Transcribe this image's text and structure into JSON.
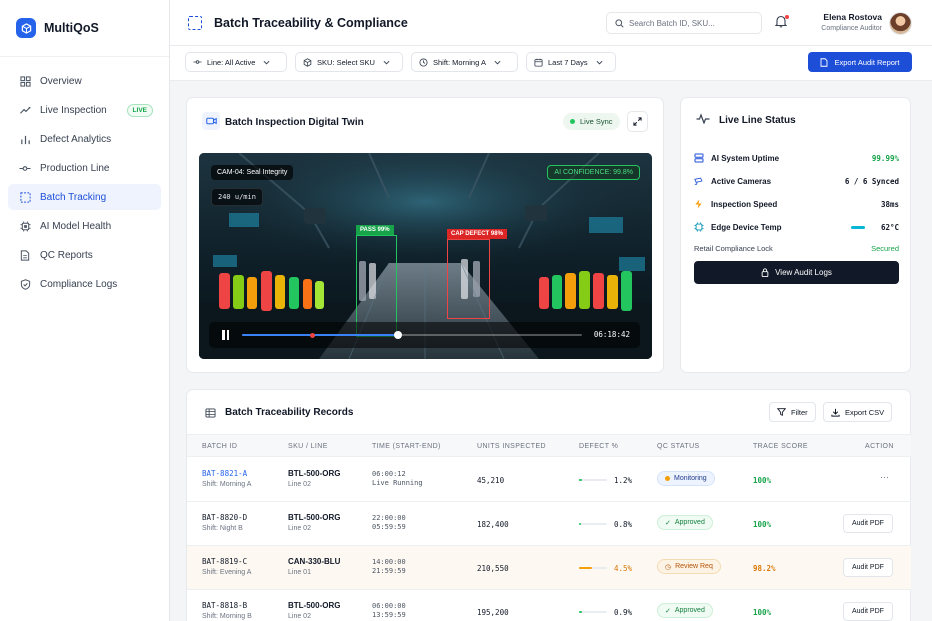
{
  "app": {
    "name": "MultiQoS"
  },
  "sidebar": {
    "items": [
      {
        "label": "Overview",
        "icon": "grid-icon"
      },
      {
        "label": "Live Inspection",
        "icon": "radar-icon",
        "badge": "LIVE"
      },
      {
        "label": "Defect Analytics",
        "icon": "bar-chart-icon"
      },
      {
        "label": "Production Line",
        "icon": "pipeline-icon"
      },
      {
        "label": "Batch Tracking",
        "icon": "scan-box-icon",
        "active": true
      },
      {
        "label": "AI Model Health",
        "icon": "chip-icon"
      },
      {
        "label": "QC Reports",
        "icon": "document-icon"
      },
      {
        "label": "Compliance Logs",
        "icon": "shield-icon"
      }
    ]
  },
  "header": {
    "title": "Batch Traceability & Compliance",
    "search_placeholder": "Search Batch ID, SKU...",
    "user_name": "Elena Rostova",
    "user_role": "Compliance Auditor"
  },
  "filters": {
    "line": "Line: All Active",
    "sku": "SKU: Select SKU",
    "shift": "Shift: Morning A",
    "range": "Last 7 Days",
    "export_label": "Export Audit Report"
  },
  "twin": {
    "title": "Batch Inspection Digital Twin",
    "sync_label": "Live Sync",
    "camera_label": "CAM-04: Seal Integrity",
    "rate_label": "240 u/min",
    "ai_label": "AI CONFIDENCE: 99.8%",
    "pass_label": "PASS 99%",
    "defect_label": "CAP DEFECT 98%",
    "timecode": "06:18:42",
    "progress": 0.46
  },
  "status": {
    "title": "Live Line Status",
    "rows": [
      {
        "label": "AI System Uptime",
        "value": "99.99%",
        "color": "#16a34a",
        "icon": "server-icon"
      },
      {
        "label": "Active Cameras",
        "value": "6 / 6 Synced",
        "color": "#111827",
        "icon": "camera-icon"
      },
      {
        "label": "Inspection Speed",
        "value": "38ms",
        "color": "#111827",
        "icon": "lightning-icon"
      },
      {
        "label": "Edge Device Temp",
        "value": "62°C",
        "color": "#111827",
        "icon": "cpu-icon"
      }
    ],
    "lock_label": "Retail Compliance Lock",
    "lock_value": "Secured",
    "logs_button": "View Audit Logs"
  },
  "records": {
    "title": "Batch Traceability Records",
    "filter_label": "Filter",
    "csv_label": "Export CSV",
    "columns": [
      "BATCH ID",
      "SKU / LINE",
      "TIME (START-END)",
      "UNITS INSPECTED",
      "DEFECT %",
      "QC STATUS",
      "TRACE SCORE",
      "ACTION"
    ],
    "rows": [
      {
        "id": "BAT-8821-A",
        "shift": "Shift: Morning A",
        "sku": "BTL-500-ORG",
        "line": "Line 02",
        "start": "06:00:12",
        "end": "Live Running",
        "units": "45,210",
        "defect": "1.2%",
        "defect_frac": 0.12,
        "status": "Monitoring",
        "score": "100%",
        "action": "···"
      },
      {
        "id": "BAT-8820-D",
        "shift": "Shift: Night B",
        "sku": "BTL-500-ORG",
        "line": "Line 02",
        "start": "22:00:00",
        "end": "05:59:59",
        "units": "182,400",
        "defect": "0.8%",
        "defect_frac": 0.08,
        "status": "Approved",
        "score": "100%",
        "action": "Audit PDF"
      },
      {
        "id": "BAT-8819-C",
        "shift": "Shift: Evening A",
        "sku": "CAN-330-BLU",
        "line": "Line 01",
        "start": "14:00:00",
        "end": "21:59:59",
        "units": "210,550",
        "defect": "4.5%",
        "defect_frac": 0.45,
        "status": "Review Req",
        "score": "98.2%",
        "action": "Audit PDF"
      },
      {
        "id": "BAT-8818-B",
        "shift": "Shift: Morning B",
        "sku": "BTL-500-ORG",
        "line": "Line 02",
        "start": "06:00:00",
        "end": "13:59:59",
        "units": "195,200",
        "defect": "0.9%",
        "defect_frac": 0.09,
        "status": "Approved",
        "score": "100%",
        "action": "Audit PDF"
      }
    ]
  }
}
